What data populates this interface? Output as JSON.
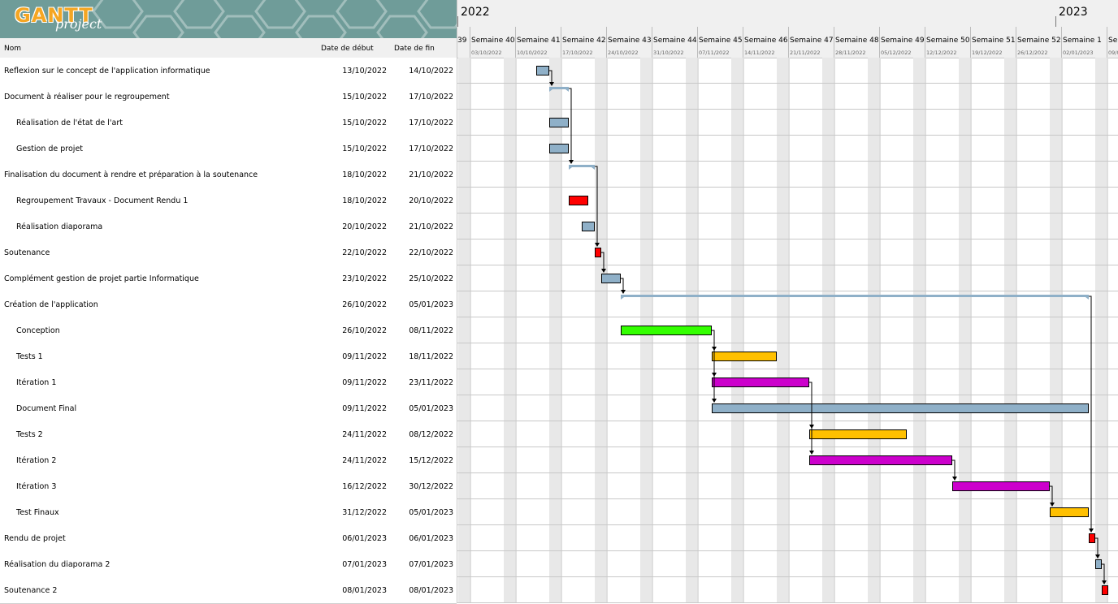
{
  "app": {
    "logo_text": "GANTT",
    "logo_sub": "project"
  },
  "table": {
    "col_name": "Nom",
    "col_start": "Date de début",
    "col_end": "Date de fin"
  },
  "timeline": {
    "years": [
      {
        "label": "2022"
      },
      {
        "label": "2023"
      }
    ],
    "weeks": [
      {
        "label": "39",
        "date": ""
      },
      {
        "label": "Semaine 40",
        "date": "03/10/2022"
      },
      {
        "label": "Semaine 41",
        "date": "10/10/2022"
      },
      {
        "label": "Semaine 42",
        "date": "17/10/2022"
      },
      {
        "label": "Semaine 43",
        "date": "24/10/2022"
      },
      {
        "label": "Semaine 44",
        "date": "31/10/2022"
      },
      {
        "label": "Semaine 45",
        "date": "07/11/2022"
      },
      {
        "label": "Semaine 46",
        "date": "14/11/2022"
      },
      {
        "label": "Semaine 47",
        "date": "21/11/2022"
      },
      {
        "label": "Semaine 48",
        "date": "28/11/2022"
      },
      {
        "label": "Semaine 49",
        "date": "05/12/2022"
      },
      {
        "label": "Semaine 50",
        "date": "12/12/2022"
      },
      {
        "label": "Semaine 51",
        "date": "19/12/2022"
      },
      {
        "label": "Semaine 52",
        "date": "26/12/2022"
      },
      {
        "label": "Semaine 1",
        "date": "02/01/2023"
      },
      {
        "label": "Sem",
        "date": "09/0"
      }
    ]
  },
  "colors": {
    "task_default": "#8fb0c8",
    "summary": "#8fb0c8",
    "red": "#ff0000",
    "green": "#33ff00",
    "yellow": "#ffc000",
    "magenta": "#cc00cc",
    "weekend": "#e8e8e8",
    "grid": "#c8c8c8"
  },
  "tasks": [
    {
      "name": "Reflexion sur le concept de l'application informatique",
      "start": "13/10/2022",
      "end": "14/10/2022",
      "indent": 0,
      "type": "task",
      "color": "default"
    },
    {
      "name": "Document à réaliser pour le regroupement",
      "start": "15/10/2022",
      "end": "17/10/2022",
      "indent": 0,
      "type": "summary",
      "color": "default"
    },
    {
      "name": "Réalisation de l'état de l'art",
      "start": "15/10/2022",
      "end": "17/10/2022",
      "indent": 1,
      "type": "task",
      "color": "default"
    },
    {
      "name": "Gestion de projet",
      "start": "15/10/2022",
      "end": "17/10/2022",
      "indent": 1,
      "type": "task",
      "color": "default"
    },
    {
      "name": "Finalisation du document à rendre et préparation à la soutenance",
      "start": "18/10/2022",
      "end": "21/10/2022",
      "indent": 0,
      "type": "summary",
      "color": "default"
    },
    {
      "name": "Regroupement Travaux - Document Rendu 1",
      "start": "18/10/2022",
      "end": "20/10/2022",
      "indent": 1,
      "type": "task",
      "color": "red"
    },
    {
      "name": "Réalisation diaporama",
      "start": "20/10/2022",
      "end": "21/10/2022",
      "indent": 1,
      "type": "task",
      "color": "default"
    },
    {
      "name": "Soutenance",
      "start": "22/10/2022",
      "end": "22/10/2022",
      "indent": 0,
      "type": "task",
      "color": "red"
    },
    {
      "name": "Complément gestion de projet partie Informatique",
      "start": "23/10/2022",
      "end": "25/10/2022",
      "indent": 0,
      "type": "task",
      "color": "default"
    },
    {
      "name": "Création de l'application",
      "start": "26/10/2022",
      "end": "05/01/2023",
      "indent": 0,
      "type": "summary",
      "color": "default"
    },
    {
      "name": "Conception",
      "start": "26/10/2022",
      "end": "08/11/2022",
      "indent": 1,
      "type": "task",
      "color": "green"
    },
    {
      "name": "Tests 1",
      "start": "09/11/2022",
      "end": "18/11/2022",
      "indent": 1,
      "type": "task",
      "color": "yellow"
    },
    {
      "name": "Itération 1",
      "start": "09/11/2022",
      "end": "23/11/2022",
      "indent": 1,
      "type": "task",
      "color": "magenta"
    },
    {
      "name": "Document Final",
      "start": "09/11/2022",
      "end": "05/01/2023",
      "indent": 1,
      "type": "task",
      "color": "default"
    },
    {
      "name": "Tests 2",
      "start": "24/11/2022",
      "end": "08/12/2022",
      "indent": 1,
      "type": "task",
      "color": "yellow"
    },
    {
      "name": "Itération 2",
      "start": "24/11/2022",
      "end": "15/12/2022",
      "indent": 1,
      "type": "task",
      "color": "magenta"
    },
    {
      "name": "Itération 3",
      "start": "16/12/2022",
      "end": "30/12/2022",
      "indent": 1,
      "type": "task",
      "color": "magenta"
    },
    {
      "name": "Test Finaux",
      "start": "31/12/2022",
      "end": "05/01/2023",
      "indent": 1,
      "type": "task",
      "color": "yellow"
    },
    {
      "name": "Rendu de projet",
      "start": "06/01/2023",
      "end": "06/01/2023",
      "indent": 0,
      "type": "task",
      "color": "red"
    },
    {
      "name": "Réalisation du diaporama 2",
      "start": "07/01/2023",
      "end": "07/01/2023",
      "indent": 0,
      "type": "task",
      "color": "default"
    },
    {
      "name": "Soutenance 2",
      "start": "08/01/2023",
      "end": "08/01/2023",
      "indent": 0,
      "type": "task",
      "color": "red"
    }
  ],
  "dependencies": [
    {
      "from": 0,
      "to": 1
    },
    {
      "from": 1,
      "to": 4
    },
    {
      "from": 4,
      "to": 7
    },
    {
      "from": 7,
      "to": 8
    },
    {
      "from": 8,
      "to": 9
    },
    {
      "from": 10,
      "to": 11
    },
    {
      "from": 10,
      "to": 12
    },
    {
      "from": 10,
      "to": 13
    },
    {
      "from": 12,
      "to": 14
    },
    {
      "from": 12,
      "to": 15
    },
    {
      "from": 15,
      "to": 16
    },
    {
      "from": 16,
      "to": 17
    },
    {
      "from": 9,
      "to": 18
    },
    {
      "from": 18,
      "to": 19
    },
    {
      "from": 19,
      "to": 20
    }
  ]
}
